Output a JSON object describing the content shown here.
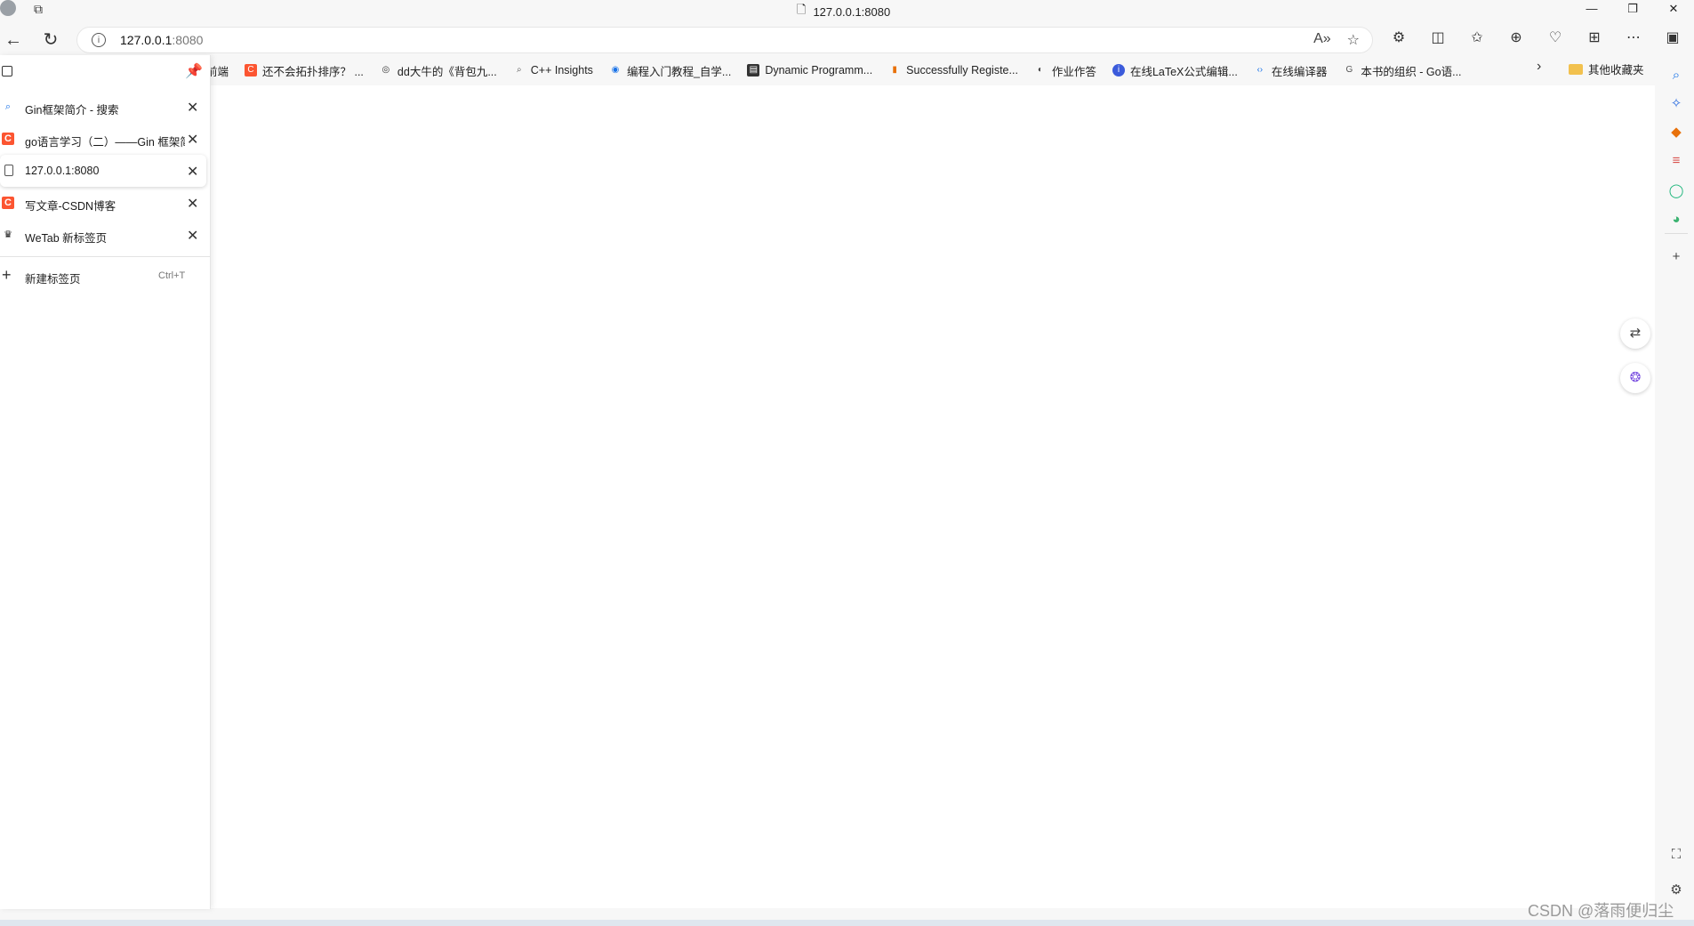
{
  "window": {
    "title": "127.0.0.1:8080",
    "controls": [
      "—",
      "❐",
      "✕"
    ]
  },
  "address_bar": {
    "url_host": "127.0.0.1",
    "url_port": ":8080"
  },
  "bookmarks": {
    "items": [
      {
        "label": "前端",
        "icon": "no-icon",
        "color": ""
      },
      {
        "label": "还不会拓扑排序？ ...",
        "icon": "csdn-icon",
        "color": "#fc5531"
      },
      {
        "label": "dd大牛的《背包九...",
        "icon": "github-icon",
        "color": "#333333"
      },
      {
        "label": "C++ Insights",
        "icon": "search-icon",
        "color": "#555555"
      },
      {
        "label": "编程入门教程_自学...",
        "icon": "runoob-icon",
        "color": "#1a73e8"
      },
      {
        "label": "Dynamic Programm...",
        "icon": "site-icon",
        "color": "#333333"
      },
      {
        "label": "Successfully Registe...",
        "icon": "chart-icon",
        "color": "#e8710a"
      },
      {
        "label": "作业作答",
        "icon": "globe-icon",
        "color": "#444444"
      },
      {
        "label": "在线LaTeX公式编辑...",
        "icon": "latex-icon",
        "color": "#3b5bdb"
      },
      {
        "label": "在线编译器",
        "icon": "code-icon",
        "color": "#1a73e8"
      },
      {
        "label": "本书的组织 - Go语...",
        "icon": "g-icon",
        "color": "#555555"
      }
    ],
    "other_label": "其他收藏夹"
  },
  "tabs": {
    "items": [
      {
        "title": "Gin框架简介 - 搜索",
        "favicon": "search-icon",
        "active": false
      },
      {
        "title": "go语言学习（二）——Gin 框架简",
        "favicon": "csdn-icon",
        "active": false
      },
      {
        "title": "127.0.0.1:8080",
        "favicon": "document-icon",
        "active": true
      },
      {
        "title": "写文章-CSDN博客",
        "favicon": "csdn-icon",
        "active": false
      },
      {
        "title": "WeTab 新标签页",
        "favicon": "wetab-icon",
        "active": false
      }
    ],
    "new_tab_label": "新建标签页",
    "new_tab_shortcut": "Ctrl+T"
  },
  "watermark": "CSDN @落雨便归尘"
}
